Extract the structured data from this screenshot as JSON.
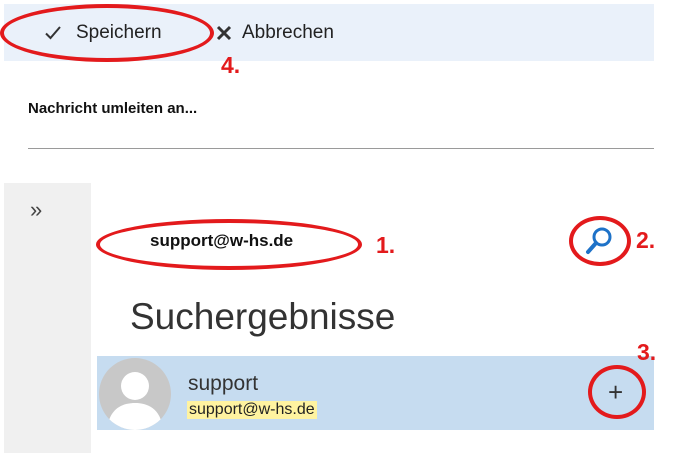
{
  "toolbar": {
    "save_label": "Speichern",
    "cancel_label": "Abbrechen"
  },
  "form": {
    "heading": "Nachricht umleiten an..."
  },
  "search": {
    "query": "support@w-hs.de",
    "icon": "search-icon"
  },
  "results": {
    "title": "Suchergebnisse",
    "items": [
      {
        "name": "support",
        "email": "support@w-hs.de",
        "action_icon": "plus-icon"
      }
    ]
  },
  "annotations": {
    "step1": "1.",
    "step2": "2.",
    "step3": "3.",
    "step4": "4.",
    "color": "#e31a1c"
  },
  "colors": {
    "toolbar_bg": "#eaf1fa",
    "selected_row_bg": "#c6dcf0",
    "highlight": "#fff3a0",
    "accent_blue": "#1e72c8"
  }
}
